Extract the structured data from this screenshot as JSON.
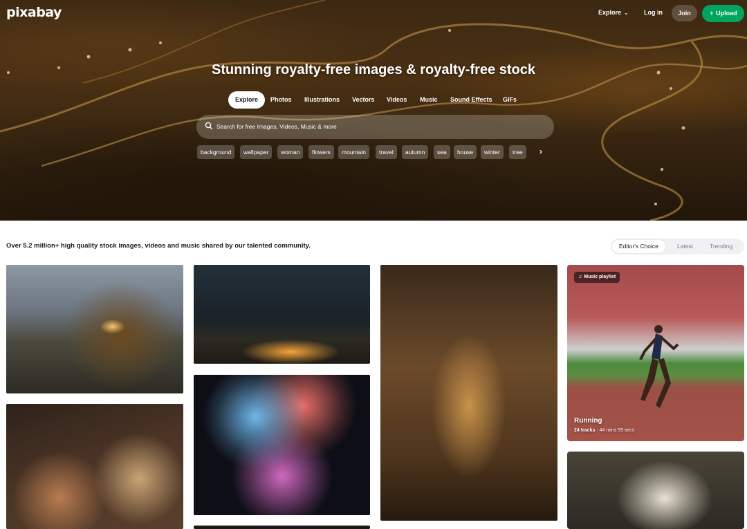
{
  "header": {
    "logo": "pixabay",
    "explore": "Explore",
    "login": "Log in",
    "join": "Join",
    "upload": "Upload"
  },
  "hero": {
    "title": "Stunning royalty-free images & royalty-free stock",
    "tabs": [
      "Explore",
      "Photos",
      "Illustrations",
      "Vectors",
      "Videos",
      "Music",
      "Sound Effects",
      "GIFs"
    ],
    "active_tab": "Explore",
    "search_placeholder": "Search for free Images, Videos, Music & more",
    "chips": [
      "background",
      "wallpaper",
      "woman",
      "flowers",
      "mountain",
      "travel",
      "autumn",
      "sea",
      "house",
      "winter",
      "tree"
    ]
  },
  "content": {
    "tagline": "Over 5.2 million+ high quality stock images, videos and music shared by our talented community.",
    "sort_options": [
      "Editor's Choice",
      "Latest",
      "Trending"
    ],
    "sort_active": "Editor's Choice"
  },
  "playlist": {
    "badge": "Music playlist",
    "title": "Running",
    "tracks": "24 tracks",
    "duration": "44 mins 59 secs"
  },
  "colors": {
    "accent": "#02a55f",
    "text": "#191b26"
  }
}
